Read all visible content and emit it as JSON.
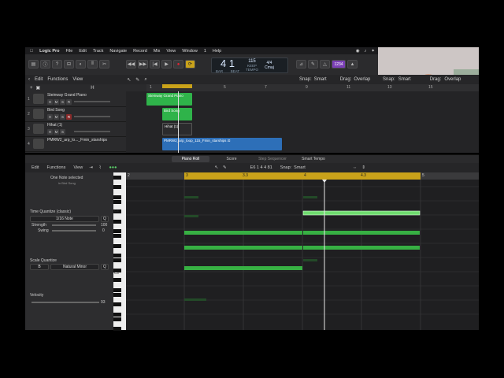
{
  "menubar": {
    "apple": "",
    "app": "Logic Pro",
    "items": [
      "File",
      "Edit",
      "Track",
      "Navigate",
      "Record",
      "Mix",
      "View",
      "Window",
      "1",
      "Help"
    ]
  },
  "lcd": {
    "position": "4 1",
    "bar_label": "BAR",
    "beat_label": "BEAT",
    "tempo": "115",
    "tempo_label": "KEEP",
    "tempo_sub": "TEMPO",
    "sig": "4/4",
    "key": "Cmaj"
  },
  "badge": "1234",
  "track_header": {
    "edit": "Edit",
    "functions": "Functions",
    "view": "View",
    "snap_label": "Snap:",
    "snap_value": "Smart",
    "drag_label": "Drag:",
    "drag_value": "Overlap"
  },
  "ruler": [
    "1",
    "3",
    "5",
    "7",
    "9",
    "11",
    "13",
    "15"
  ],
  "tracks": [
    {
      "num": "1",
      "name": "Steinway Grand Piano"
    },
    {
      "num": "2",
      "name": "Bird Song"
    },
    {
      "num": "3",
      "name": "Hihat (1)"
    },
    {
      "num": "4",
      "name": "PMRW2_arp_lo..._Fmin_starships"
    }
  ],
  "track_buttons": {
    "h": "H",
    "m": "M",
    "s": "S",
    "r": "R"
  },
  "regions": {
    "piano": "Steinway Grand Piano",
    "bird": "Bird Song",
    "hihat": "Hihat (1)",
    "audio": "PMRW2_arp_loop_115_Fmin_starships ⊡"
  },
  "tabs": [
    "Piano Roll",
    "Score",
    "Step Sequencer",
    "Smart Tempo"
  ],
  "pr_header": {
    "edit": "Edit",
    "functions": "Functions",
    "view": "View",
    "position": "E6  1 4 4 81",
    "snap_label": "Snap:",
    "snap_value": "Smart"
  },
  "inspector": {
    "title": "One Note selected",
    "subtitle": "in Bird Song",
    "time_quantize": "Time Quantize (classic)",
    "tq_value": "1/16 Note",
    "q": "Q",
    "strength_label": "Strength",
    "strength_value": "100",
    "swing_label": "Swing",
    "swing_value": "0",
    "scale_quantize": "Scale Quantize",
    "sq_key": "B",
    "sq_scale": "Natural Minor",
    "velocity_label": "Velocity",
    "velocity_value": "93"
  },
  "pr_ruler": [
    "2",
    "3",
    "3.3",
    "4",
    "4.3",
    "5"
  ],
  "key_label_c4": "C4",
  "key_label_c3": "C3"
}
